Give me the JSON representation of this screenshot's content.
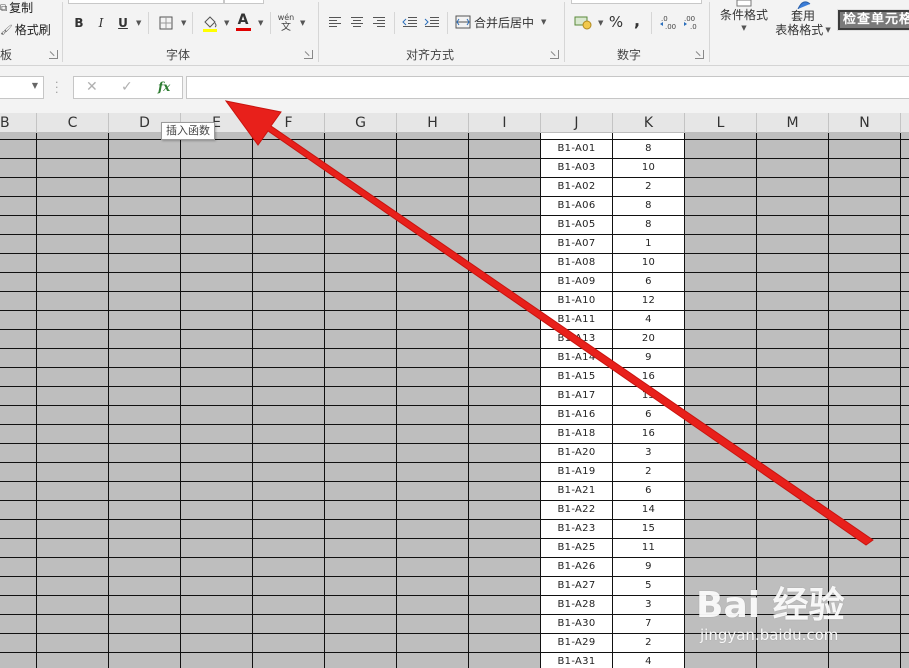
{
  "ribbon": {
    "clipboard": {
      "copy_label": "复制",
      "format_painter_label": "格式刷",
      "group_label_partial": "板"
    },
    "font": {
      "group_label": "字体",
      "bold": "B",
      "italic": "I",
      "underline": "U",
      "font_color_glyph": "A",
      "phonetic_glyph": "wén\n文"
    },
    "alignment": {
      "group_label": "对齐方式",
      "merge_center_label": "合并后居中"
    },
    "number": {
      "group_label": "数字",
      "percent": "%",
      "comma": ",",
      "increase_decimal": "+.0\n.00",
      "decrease_decimal": ".00\n→.0"
    },
    "styles": {
      "conditional_format_label": "条件格式",
      "table_format_label_1": "套用",
      "table_format_label_2": "表格格式",
      "check_cell_label": "检查单元格"
    }
  },
  "formula_bar": {
    "name_box_value": "",
    "cancel_glyph": "✕",
    "enter_glyph": "✓",
    "fx_glyph": "fx",
    "formula_value": ""
  },
  "tooltip": {
    "text": "插入函数"
  },
  "columns": [
    "B",
    "C",
    "D",
    "E",
    "F",
    "G",
    "H",
    "I",
    "J",
    "K",
    "L",
    "M",
    "N"
  ],
  "rows": [
    {
      "j": "B1-A01",
      "k": "8"
    },
    {
      "j": "B1-A03",
      "k": "10"
    },
    {
      "j": "B1-A02",
      "k": "2"
    },
    {
      "j": "B1-A06",
      "k": "8"
    },
    {
      "j": "B1-A05",
      "k": "8"
    },
    {
      "j": "B1-A07",
      "k": "1"
    },
    {
      "j": "B1-A08",
      "k": "10"
    },
    {
      "j": "B1-A09",
      "k": "6"
    },
    {
      "j": "B1-A10",
      "k": "12"
    },
    {
      "j": "B1-A11",
      "k": "4"
    },
    {
      "j": "B1-A13",
      "k": "20"
    },
    {
      "j": "B1-A14",
      "k": "9"
    },
    {
      "j": "B1-A15",
      "k": "16"
    },
    {
      "j": "B1-A17",
      "k": "15"
    },
    {
      "j": "B1-A16",
      "k": "6"
    },
    {
      "j": "B1-A18",
      "k": "16"
    },
    {
      "j": "B1-A20",
      "k": "3"
    },
    {
      "j": "B1-A19",
      "k": "2"
    },
    {
      "j": "B1-A21",
      "k": "6"
    },
    {
      "j": "B1-A22",
      "k": "14"
    },
    {
      "j": "B1-A23",
      "k": "15"
    },
    {
      "j": "B1-A25",
      "k": "11"
    },
    {
      "j": "B1-A26",
      "k": "9"
    },
    {
      "j": "B1-A27",
      "k": "5"
    },
    {
      "j": "B1-A28",
      "k": "3"
    },
    {
      "j": "B1-A30",
      "k": "7"
    },
    {
      "j": "B1-A29",
      "k": "2"
    },
    {
      "j": "B1-A31",
      "k": "4"
    }
  ],
  "colors": {
    "sheet_fill": "#bebebe",
    "highlight_fill": "#ffffff",
    "arrow": "#e8201b",
    "fx_green": "#2e7d32"
  },
  "watermark": {
    "logo": "Bai 经验",
    "url": "jingyan.baidu.com"
  }
}
